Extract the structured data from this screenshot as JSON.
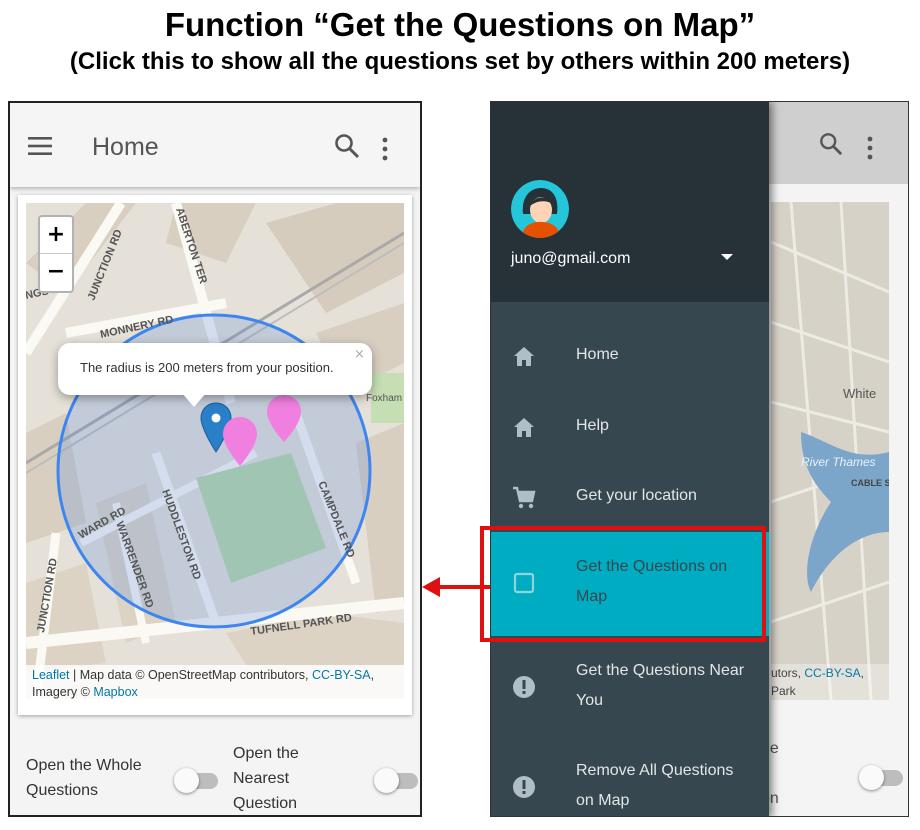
{
  "heading": {
    "title": "Function “Get the Questions on Map”",
    "subtitle": "(Click this to show all the questions set by others within 200 meters)"
  },
  "left_screen": {
    "appbar": {
      "title": "Home",
      "icons": [
        "menu-icon",
        "search-icon",
        "more-vert-icon"
      ]
    },
    "map": {
      "zoom_in": "+",
      "zoom_out": "−",
      "street_labels": [
        "JUNCTION RD",
        "ABERTON TER",
        "MONNERY RD",
        "HUDDLESTON RD",
        "WARRENDER RD",
        "WARD RD",
        "CAMPDALE RD",
        "TUFNELL PARK RD",
        "JUNCTION RD",
        "NGS RD",
        "Foxham Garden"
      ],
      "popup_text": "The radius is 200 meters from your position.",
      "popup_close": "×",
      "attribution": {
        "leaflet": "Leaflet",
        "text1": " | Map data © OpenStreetMap contributors, ",
        "license": "CC-BY-SA",
        "text2": ",",
        "text3": "Imagery © ",
        "mapbox": "Mapbox"
      },
      "circle_color": "#3d86f0",
      "marker_colors": {
        "user": "#2a7fc9",
        "question": "#f07fe0"
      }
    },
    "toggles": [
      {
        "label_line1": "Open the Whole",
        "label_line2": "Questions",
        "on": false
      },
      {
        "label_line1": "Open the",
        "label_line2": "Nearest",
        "label_line3": "Question",
        "on": false
      }
    ]
  },
  "right_screen": {
    "drawer": {
      "email": "juno@gmail.com",
      "items": [
        {
          "icon": "home-icon",
          "label": "Home"
        },
        {
          "icon": "home-icon",
          "label": "Help"
        },
        {
          "icon": "cart-icon",
          "label": "Get your location"
        },
        {
          "icon": "square-icon",
          "label_line1": "Get the Questions on",
          "label_line2": "Map",
          "active": true
        },
        {
          "icon": "alert-icon",
          "label_line1": "Get the Questions Near",
          "label_line2": "You"
        },
        {
          "icon": "alert-icon",
          "label_line1": "Remove All Questions",
          "label_line2": "on Map"
        }
      ],
      "accent_color": "#00acc1"
    },
    "background": {
      "map_labels": [
        "White",
        "CABLE ST",
        "River Thames"
      ],
      "attr_text1": "utors, ",
      "attr_license": "CC-BY-SA",
      "attr_text2": ",",
      "attr_text3": "Park",
      "toggle_text": [
        "he",
        "t",
        "on"
      ]
    }
  },
  "annotation": {
    "highlight_color": "#e01010"
  }
}
